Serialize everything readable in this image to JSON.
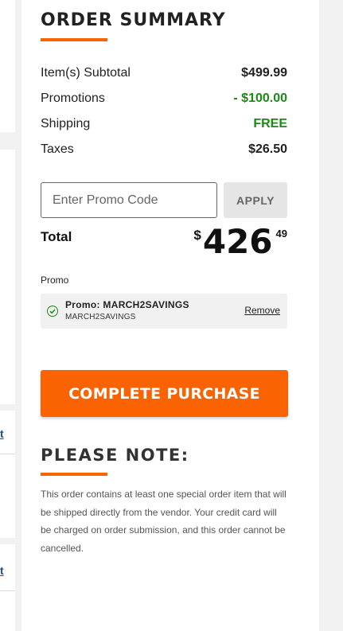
{
  "left_links": [
    "t",
    "t"
  ],
  "order_summary": {
    "title": "ORDER SUMMARY",
    "rows": [
      {
        "label": "Item(s) Subtotal",
        "value": "$499.99"
      },
      {
        "label": "Promotions",
        "value": "- $100.00"
      },
      {
        "label": "Shipping",
        "value": "FREE"
      },
      {
        "label": "Taxes",
        "value": "$26.50"
      }
    ],
    "promo_input": {
      "placeholder": "Enter Promo Code",
      "value": ""
    },
    "apply_label": "APPLY",
    "total": {
      "label": "Total",
      "currency": "$",
      "whole": "426",
      "cents": "49"
    },
    "promo": {
      "heading": "Promo",
      "name": "Promo: MARCH2SAVINGS",
      "code": "MARCH2SAVINGS",
      "remove_label": "Remove"
    },
    "complete_purchase_label": "COMPLETE PURCHASE",
    "note": {
      "title": "PLEASE NOTE:",
      "text": "This order contains at least one special order item that will be shipped directly from the vendor. Your credit card will be charged on order submission, and this order cannot be cancelled."
    }
  },
  "colors": {
    "accent": "#f96302",
    "green": "#1a8a14"
  }
}
